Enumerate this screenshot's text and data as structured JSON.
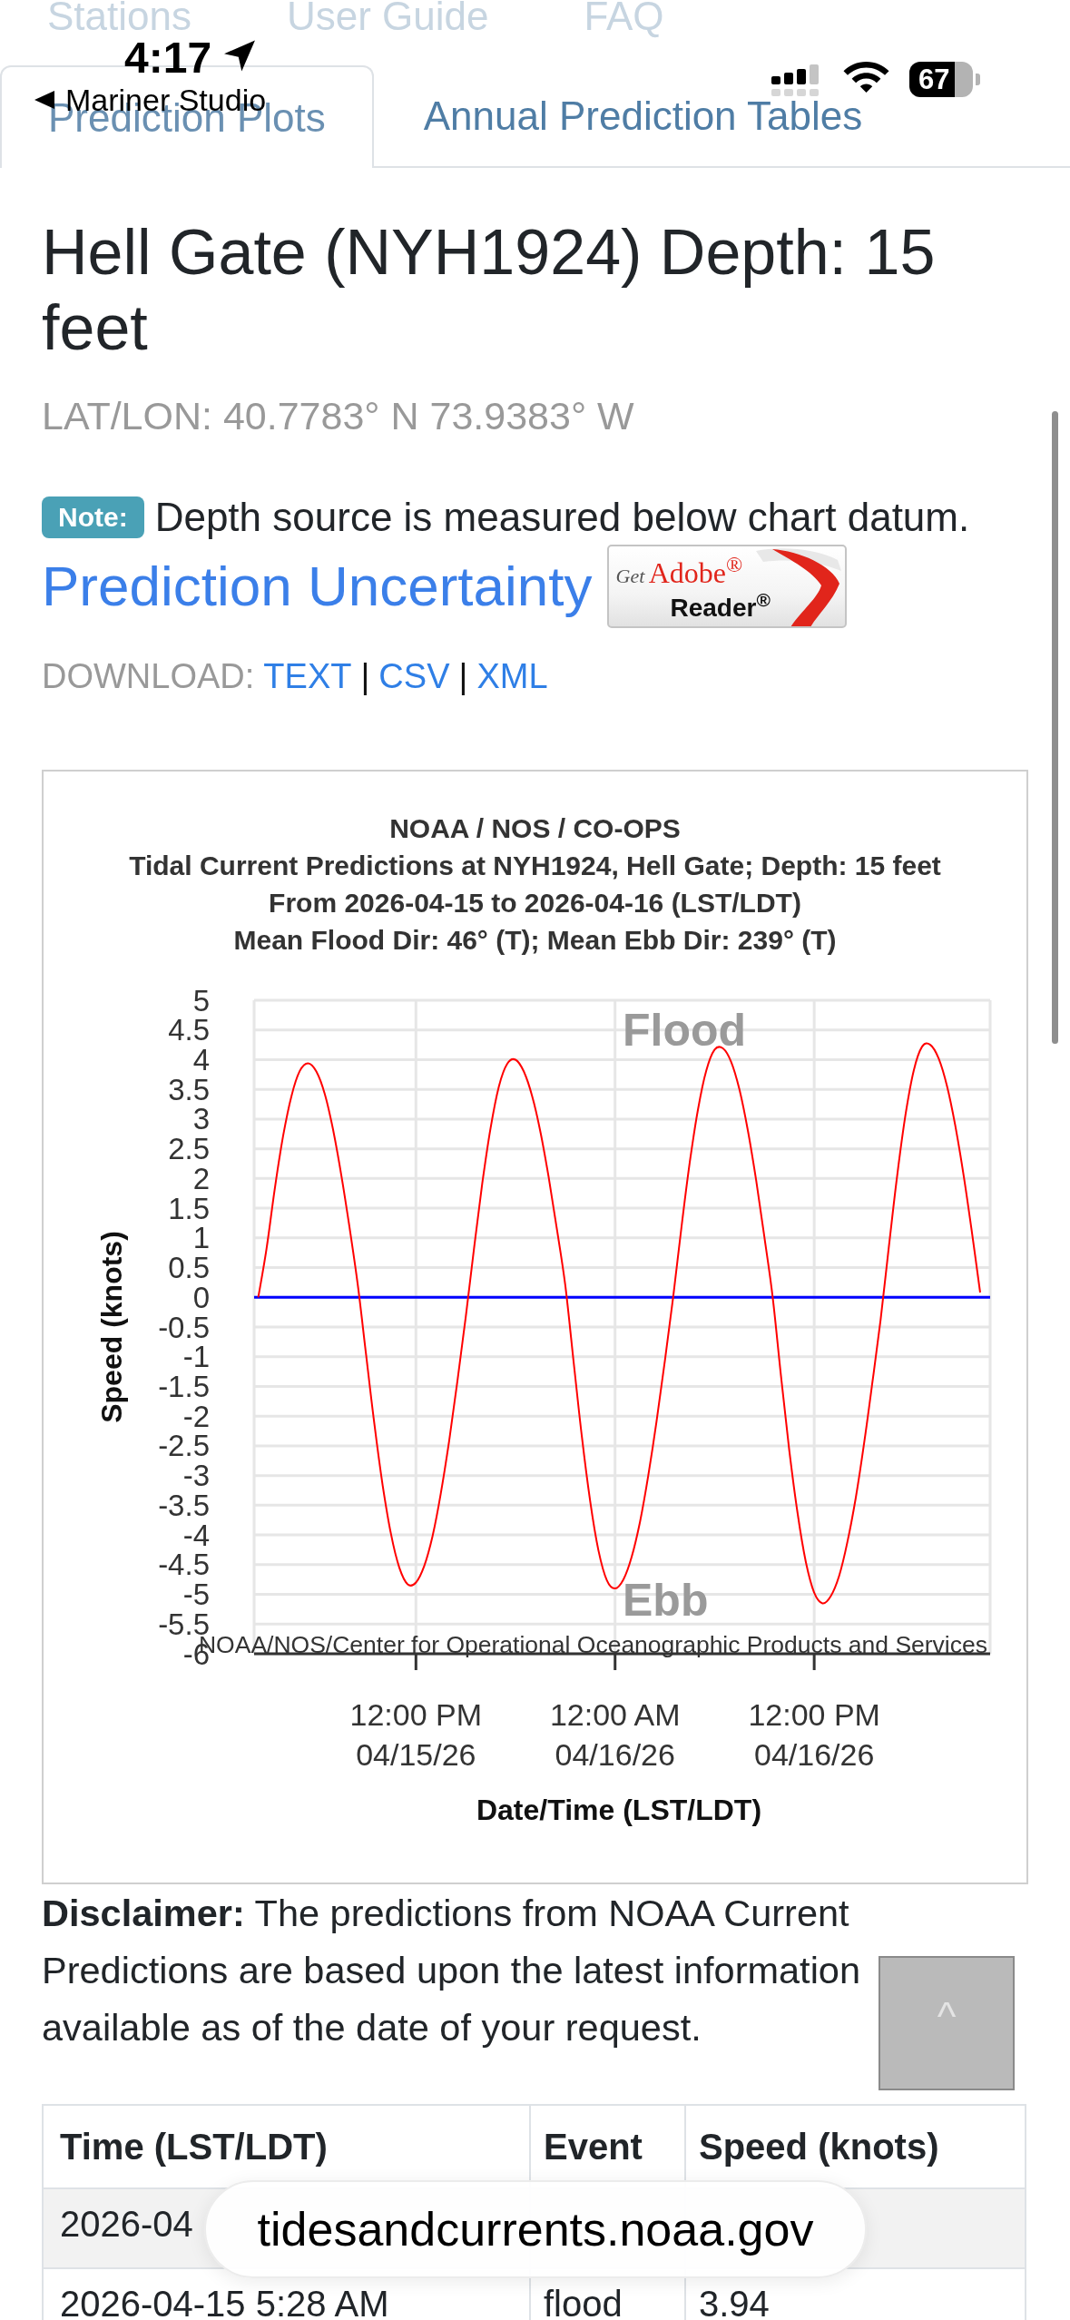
{
  "nav_links": [
    "Stations",
    "User Guide",
    "FAQ"
  ],
  "status_bar": {
    "time": "4:17",
    "back_label": "Mariner Studio",
    "battery": "67"
  },
  "tabs": [
    {
      "label": "Prediction Plots",
      "selected": true
    },
    {
      "label": "Annual Prediction Tables",
      "selected": false
    }
  ],
  "title": "Hell Gate (NYH1924) Depth: 15 feet",
  "coordinates": "LAT/LON: 40.7783° N 73.9383° W",
  "note": {
    "badge": "Note:",
    "text": "Depth source is measured below chart datum."
  },
  "uncertainty_link": "Prediction Uncertainty",
  "reader_badge": {
    "get": "Get",
    "brand": "Adobe$^{®}$",
    "product": "Reader$^{®}$"
  },
  "download": {
    "label": "DOWNLOAD:",
    "links": [
      "TEXT",
      "CSV",
      "XML"
    ],
    "separator": "|"
  },
  "chart": {
    "title_lines": [
      "NOAA / NOS / CO-OPS",
      "Tidal Current Predictions at NYH1924, Hell Gate; Depth: 15 feet",
      "From 2026-04-15 to 2026-04-16 (LST/LDT)",
      "Mean Flood Dir: 46° (T); Mean Ebb Dir: 239° (T)"
    ],
    "credit": "NOAA/NOS/Center for Operational Oceanographic Products and Services",
    "chart_data": {
      "type": "line",
      "xlabel": "Date/Time (LST/LDT)",
      "ylabel": "Speed (knots)",
      "grid": true,
      "categories": [
        null,
        null,
        null,
        null,
        null,
        null,
        null,
        null,
        null,
        null,
        null,
        null,
        null,
        null,
        null,
        null,
        null,
        null,
        null,
        "12:00 PM\n04/15/26",
        null,
        null,
        null,
        null,
        null,
        null,
        null,
        null,
        null,
        null,
        null,
        null,
        null,
        null,
        null,
        null,
        null,
        null,
        null,
        null,
        null,
        null,
        null,
        "12:00 AM\n04/16/26",
        null,
        null,
        null,
        null,
        null,
        null,
        null,
        null,
        null,
        null,
        null,
        null,
        null,
        null,
        null,
        null,
        null,
        null,
        null,
        null,
        null,
        null,
        null,
        "12:00 PM\n04/16/26",
        null,
        null,
        null,
        null,
        null,
        null,
        null,
        null,
        null,
        null,
        null,
        null,
        null,
        null,
        null,
        null,
        null,
        null,
        null,
        null
      ],
      "series": [
        {
          "color": "#ff0000",
          "values": [
            0,
            0.82,
            1.84,
            2.72,
            3.39,
            3.81,
            3.94,
            3.8,
            3.43,
            2.83,
            2.06,
            1.17,
            0.2,
            -0.98,
            -2.14,
            -3.17,
            -3.99,
            -4.55,
            -4.83,
            -4.8,
            -4.52,
            -4.02,
            -3.3,
            -2.42,
            -1.41,
            -0.33,
            0.82,
            1.92,
            2.85,
            3.55,
            3.93,
            4.0,
            3.8,
            3.39,
            2.79,
            2.02,
            1.14,
            0.2,
            -1.08,
            -2.35,
            -3.43,
            -4.26,
            -4.76,
            -4.9,
            -4.75,
            -4.37,
            -3.78,
            -3.0,
            -2.09,
            -1.07,
            0,
            1.18,
            2.27,
            3.17,
            3.82,
            4.17,
            4.19,
            3.96,
            3.49,
            2.81,
            1.97,
            1.01,
            0,
            -1.33,
            -2.58,
            -3.64,
            -4.46,
            -4.97,
            -5.15,
            -5.03,
            -4.69,
            -4.12,
            -3.38,
            -2.47,
            -1.45,
            -0.38,
            0.85,
            2.05,
            3.07,
            3.82,
            4.22,
            4.25,
            4.02,
            3.56,
            2.89,
            2.06,
            1.1,
            0.08
          ]
        }
      ],
      "ylim": [
        -6,
        5
      ],
      "yticks": [
        5,
        4.5,
        4,
        3.5,
        3,
        2.5,
        2,
        1.5,
        1,
        0.5,
        0,
        -0.5,
        -1,
        -1.5,
        -2,
        -2.5,
        -3,
        -3.5,
        -4,
        -4.5,
        -5,
        -5.5,
        -6
      ],
      "ref_lines": [
        {
          "axis": "y",
          "value": 0,
          "color": "#0000ff"
        }
      ],
      "annotations": [
        "Flood",
        "Ebb"
      ]
    }
  },
  "disclaimer": "**Disclaimer:** The predictions from NOAA Current Predictions are based upon the latest information available as of the date of your request.",
  "scroll_top_button": "^",
  "table": {
    "columns": [
      "Time (LST/LDT)",
      "Event",
      "Speed (knots)"
    ],
    "rows": [
      [
        "2026-04"
      ],
      [
        "2026-04-15 5:28 AM",
        "flood",
        "3.94"
      ]
    ]
  },
  "address_bar": "tidesandcurrents.noaa.gov"
}
